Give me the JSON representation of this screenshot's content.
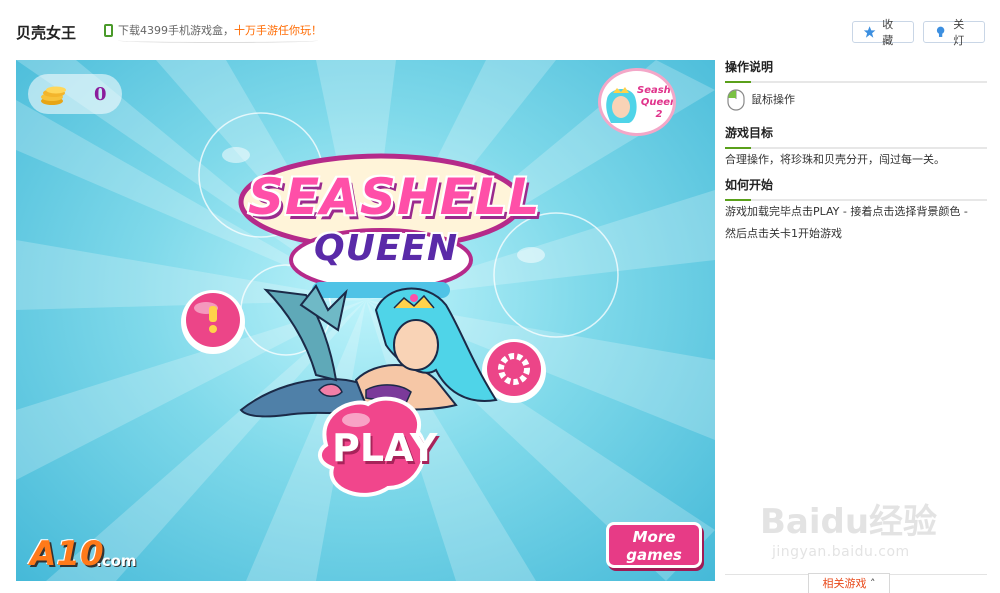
{
  "header": {
    "title": "贝壳女王",
    "promo_text": "下载4399手机游戏盒，",
    "promo_highlight": "十万手游任你玩！",
    "favorite_label": "收藏",
    "light_off_label": "关灯"
  },
  "game": {
    "coin_count": "0",
    "badge_text": "Seashell Queen 2",
    "logo_line1": "SEASHELL",
    "logo_line2": "QUEEN",
    "play_label": "PLAY",
    "more_games_label": "More games",
    "brand_main": "A10",
    "brand_sub": ".com",
    "colors": {
      "pink": "#ff4fa8",
      "purple": "#5a2aa8",
      "sky": "#7fd9ea"
    }
  },
  "panel": {
    "instructions_heading": "操作说明",
    "mouse_label": "鼠标操作",
    "goal_heading": "游戏目标",
    "goal_text": "合理操作，将珍珠和贝壳分开，闯过每一关。",
    "start_heading": "如何开始",
    "start_line1": "游戏加载完毕点击PLAY - 接着点击选择背景颜色 -",
    "start_line2": "然后点击关卡1开始游戏",
    "related_label": "相关游戏"
  },
  "watermark": {
    "main": "Baidu经验",
    "sub": "jingyan.baidu.com"
  }
}
